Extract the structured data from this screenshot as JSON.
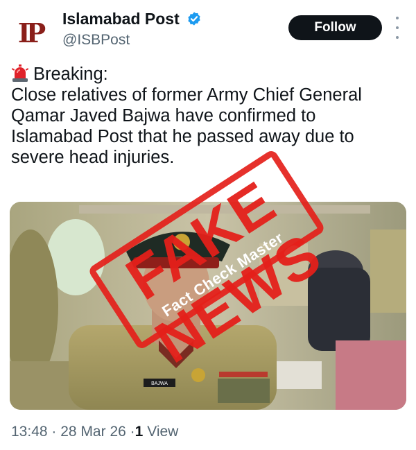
{
  "account": {
    "avatar_text": "IP",
    "display_name": "Islamabad Post",
    "handle": "@ISBPost",
    "verified": true,
    "follow_label": "Follow",
    "brand_color": "#8a1f1a"
  },
  "tweet": {
    "icon": "police-siren-emoji",
    "lines": [
      "Breaking:",
      "Close relatives of former Army Chief General",
      "Qamar Javed Bajwa have confirmed to",
      "Islamabad Post that he passed away due to",
      "severe head injuries."
    ]
  },
  "media": {
    "name_tag": "BAJWA"
  },
  "stamp": {
    "title": "FAKE NEWS",
    "subtitle": "Fact Check Master",
    "color": "#e4201a"
  },
  "meta": {
    "time": "13:48",
    "date": "28 Mar 26",
    "views_count": "1",
    "views_label": "View",
    "separator": "·"
  }
}
